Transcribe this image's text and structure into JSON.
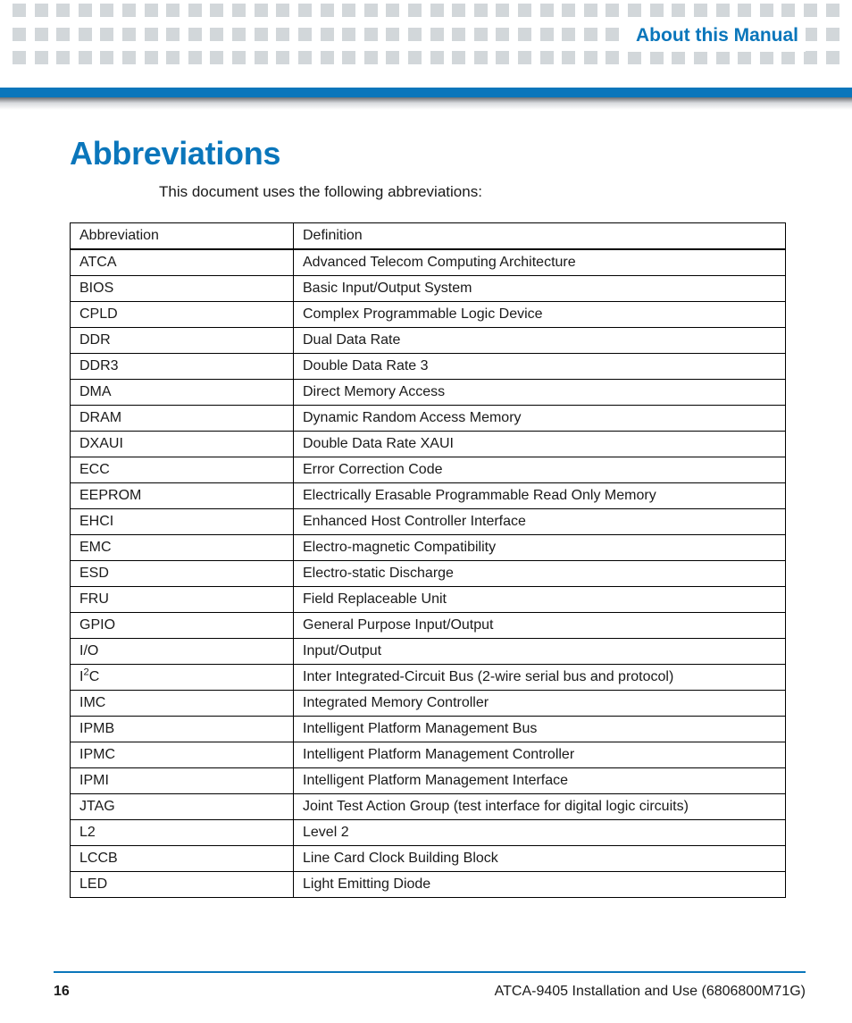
{
  "header": {
    "title": "About this Manual"
  },
  "section": {
    "heading": "Abbreviations",
    "intro": "This document uses the following abbreviations:"
  },
  "table": {
    "col1": "Abbreviation",
    "col2": "Definition",
    "rows": [
      {
        "abbr": "ATCA",
        "def": "Advanced Telecom Computing Architecture"
      },
      {
        "abbr": "BIOS",
        "def": "Basic Input/Output System"
      },
      {
        "abbr": "CPLD",
        "def": "Complex Programmable Logic Device"
      },
      {
        "abbr": "DDR",
        "def": "Dual Data Rate"
      },
      {
        "abbr": "DDR3",
        "def": "Double Data Rate 3"
      },
      {
        "abbr": "DMA",
        "def": "Direct Memory Access"
      },
      {
        "abbr": "DRAM",
        "def": "Dynamic Random Access Memory"
      },
      {
        "abbr": "DXAUI",
        "def": "Double Data Rate XAUI"
      },
      {
        "abbr": "ECC",
        "def": "Error Correction Code"
      },
      {
        "abbr": "EEPROM",
        "def": "Electrically Erasable Programmable Read Only Memory"
      },
      {
        "abbr": "EHCI",
        "def": "Enhanced Host Controller Interface"
      },
      {
        "abbr": "EMC",
        "def": "Electro-magnetic Compatibility"
      },
      {
        "abbr": "ESD",
        "def": "Electro-static Discharge"
      },
      {
        "abbr": "FRU",
        "def": "Field Replaceable Unit"
      },
      {
        "abbr": "GPIO",
        "def": "General Purpose Input/Output"
      },
      {
        "abbr": "I/O",
        "def": "Input/Output"
      },
      {
        "abbr": "I2C",
        "def": "Inter Integrated-Circuit Bus (2-wire serial bus and protocol)",
        "abbr_html": "I<sup>2</sup>C"
      },
      {
        "abbr": "IMC",
        "def": "Integrated Memory Controller"
      },
      {
        "abbr": "IPMB",
        "def": "Intelligent Platform Management Bus"
      },
      {
        "abbr": "IPMC",
        "def": "Intelligent Platform Management Controller"
      },
      {
        "abbr": "IPMI",
        "def": "Intelligent Platform Management Interface"
      },
      {
        "abbr": "JTAG",
        "def": "Joint Test Action Group (test interface for digital logic circuits)"
      },
      {
        "abbr": "L2",
        "def": "Level 2"
      },
      {
        "abbr": "LCCB",
        "def": "Line Card Clock Building Block"
      },
      {
        "abbr": "LED",
        "def": "Light Emitting Diode"
      }
    ]
  },
  "footer": {
    "page": "16",
    "doc": "ATCA-9405 Installation and Use (6806800M71G)"
  }
}
